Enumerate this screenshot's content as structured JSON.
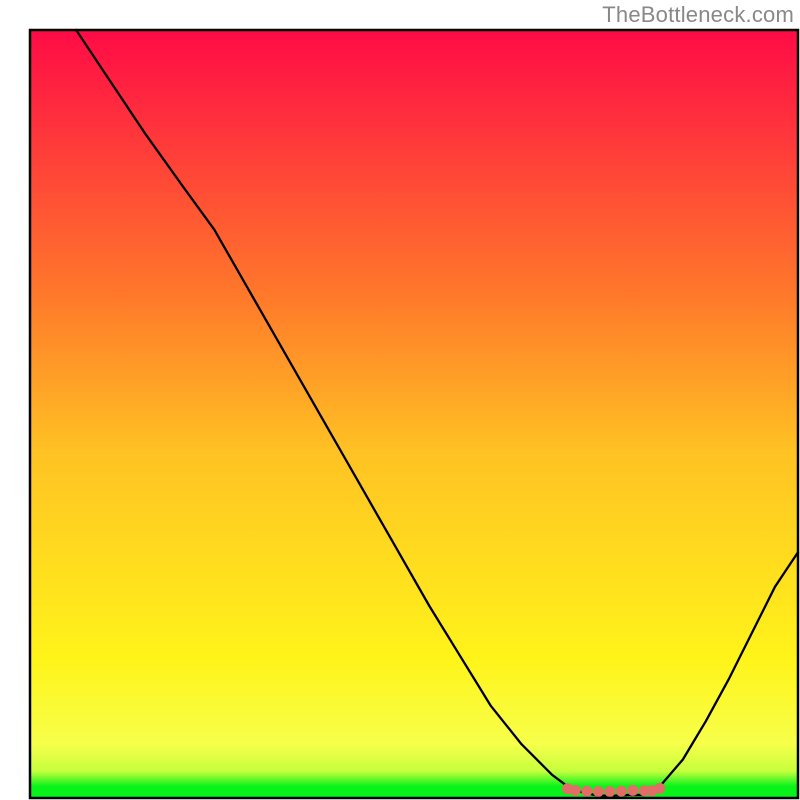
{
  "watermark": "TheBottleneck.com",
  "chart_data": {
    "type": "line",
    "title": "",
    "xlabel": "",
    "ylabel": "",
    "xlim": [
      0,
      100
    ],
    "ylim": [
      0,
      100
    ],
    "grid": false,
    "legend": false,
    "curve": {
      "x": [
        6,
        10,
        15,
        20,
        24,
        28,
        32,
        36,
        40,
        44,
        48,
        52,
        56,
        60,
        64,
        68,
        70,
        72,
        74,
        76,
        78,
        80,
        82,
        85,
        88,
        91,
        94,
        97,
        100
      ],
      "y": [
        100,
        94,
        86.5,
        79.5,
        74,
        67,
        60,
        53,
        46,
        39,
        32,
        25,
        18.5,
        12,
        7,
        3,
        1.5,
        0.7,
        0.3,
        0.3,
        0.4,
        0.4,
        1.5,
        5,
        10,
        15.5,
        21.5,
        27.5,
        32
      ]
    },
    "bottom_band": {
      "color": "#07f31a",
      "y_from": 0,
      "y_to": 1.5
    },
    "markers": {
      "color": "#e26d66",
      "points": [
        {
          "x": 70,
          "y": 1.2
        },
        {
          "x": 71,
          "y": 1.0
        },
        {
          "x": 72.5,
          "y": 0.9
        },
        {
          "x": 74,
          "y": 0.85
        },
        {
          "x": 75.5,
          "y": 0.85
        },
        {
          "x": 77,
          "y": 0.9
        },
        {
          "x": 78.5,
          "y": 1.0
        },
        {
          "x": 80,
          "y": 0.95
        },
        {
          "x": 81,
          "y": 0.95
        },
        {
          "x": 82,
          "y": 1.25
        }
      ]
    },
    "gradient_stops": [
      {
        "offset": 0,
        "color": "#ff0b46"
      },
      {
        "offset": 35,
        "color": "#ff7a2a"
      },
      {
        "offset": 55,
        "color": "#ffc223"
      },
      {
        "offset": 82,
        "color": "#fff41a"
      },
      {
        "offset": 93,
        "color": "#f6ff4a"
      },
      {
        "offset": 96.5,
        "color": "#c6ff3d"
      },
      {
        "offset": 98.5,
        "color": "#07f31a"
      },
      {
        "offset": 100,
        "color": "#07f31a"
      }
    ]
  }
}
